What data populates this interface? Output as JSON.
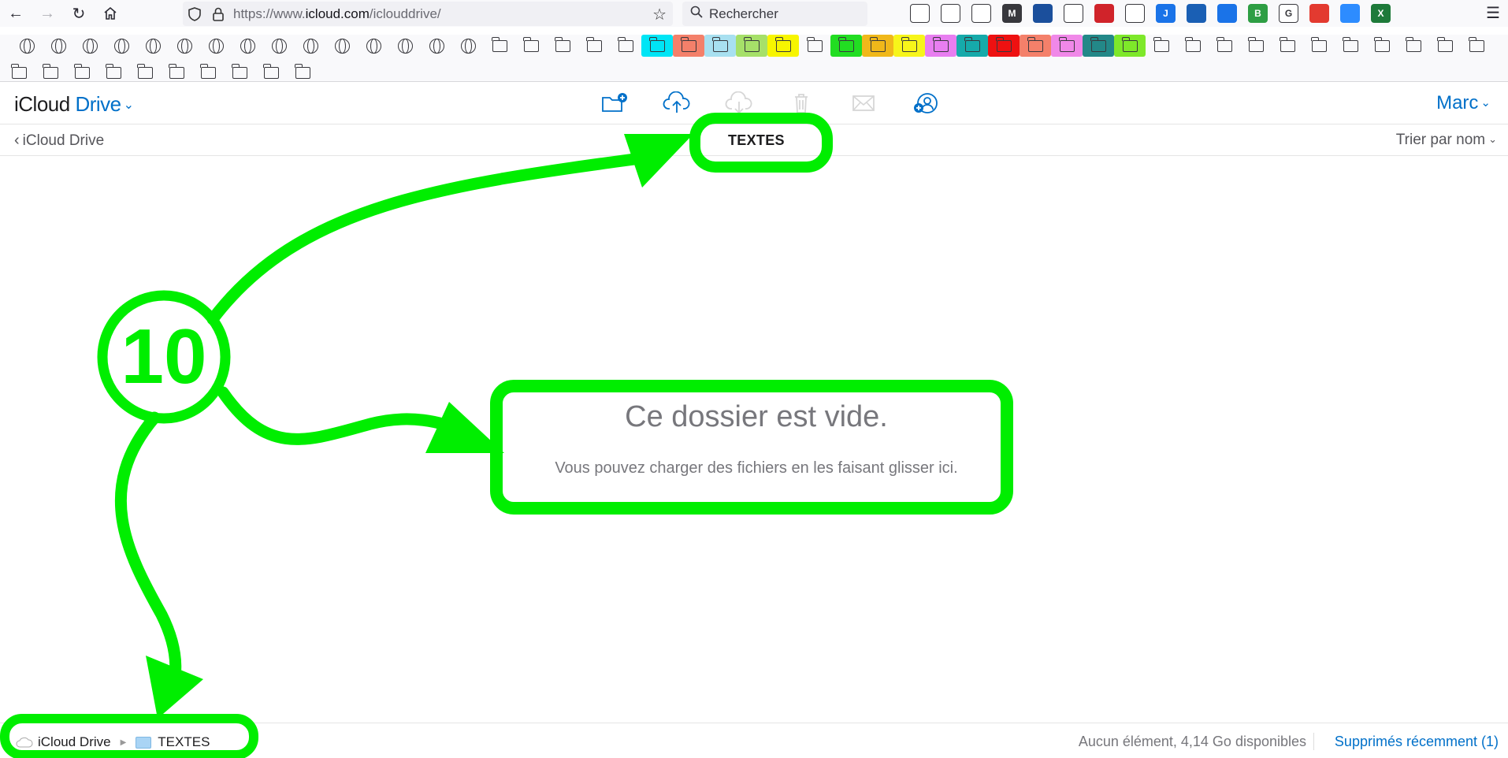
{
  "browser": {
    "url_prefix": "https://www.",
    "url_domain": "icloud.com",
    "url_path": "/iclouddrive/",
    "search_placeholder": "Rechercher",
    "toolbar_icons": [
      {
        "name": "pocket-icon",
        "color": "#ffffff",
        "label": ""
      },
      {
        "name": "download-icon",
        "color": "#ffffff",
        "label": ""
      },
      {
        "name": "reader-icon",
        "color": "#ffffff",
        "label": ""
      },
      {
        "name": "m-extension-icon",
        "color": "#38383d",
        "label": "M"
      },
      {
        "name": "extension-icon",
        "color": "#1b4f9c",
        "label": ""
      },
      {
        "name": "grid-extension-icon",
        "color": "#ffffff",
        "label": ""
      },
      {
        "name": "red-extension-icon",
        "color": "#d0232a",
        "label": ""
      },
      {
        "name": "shoe-extension-icon",
        "color": "#ffffff",
        "label": ""
      },
      {
        "name": "j-extension-icon",
        "color": "#1a73e8",
        "label": "J"
      },
      {
        "name": "download-extension-icon",
        "color": "#1a5fb4",
        "label": ""
      },
      {
        "name": "badge-extension-icon",
        "color": "#1a73e8",
        "label": ""
      },
      {
        "name": "b-extension-icon",
        "color": "#2e9e44",
        "label": "B"
      },
      {
        "name": "g-extension-icon",
        "color": "#ffffff",
        "label": "G"
      },
      {
        "name": "camera-extension-icon",
        "color": "#e33a30",
        "label": ""
      },
      {
        "name": "zoom-extension-icon",
        "color": "#2d8cff",
        "label": ""
      },
      {
        "name": "x-extension-icon",
        "color": "#1e7a3a",
        "label": "X"
      }
    ]
  },
  "bookmarks": {
    "row1": [
      "globe",
      "gem",
      "globe",
      "cloud",
      "shield",
      "globe-blue",
      "orange",
      "globe",
      "dash",
      "globe",
      "ring",
      "globe",
      "bag",
      "globe",
      "globe",
      "folder",
      "folder",
      "folder",
      "folder",
      "folder"
    ],
    "colored_folders": [
      "#00e5f5",
      "#f4806a",
      "#a8e0f0",
      "#a6e069",
      "#f7f500",
      "#ffffff",
      "#22dd22",
      "#f0b81a",
      "#f7f51a",
      "#e87ef0",
      "#16aaaa",
      "#ee1111",
      "#f4806a",
      "#f088e8",
      "#238888",
      "#7ee82a"
    ],
    "row1_tail_folders": 11,
    "row2_folders": 10
  },
  "header": {
    "title_prefix": "iCloud",
    "title_drive": "Drive",
    "user": "Marc"
  },
  "subbar": {
    "back_label": "iCloud Drive",
    "folder_title": "TEXTES",
    "sort_label": "Trier par nom"
  },
  "empty_state": {
    "title": "Ce dossier est vide.",
    "subtitle": "Vous pouvez charger des fichiers en les faisant glisser ici."
  },
  "footer": {
    "path_root": "iCloud Drive",
    "path_folder": "TEXTES",
    "status": "Aucun élément, 4,14 Go disponibles",
    "recently_deleted": "Supprimés récemment (1)"
  },
  "annotation": {
    "step_number": "10",
    "color": "#00ff00"
  }
}
